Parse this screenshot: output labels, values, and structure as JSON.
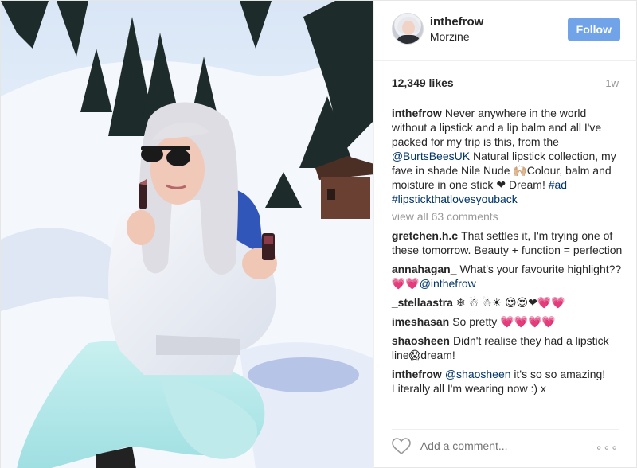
{
  "header": {
    "username": "inthefrow",
    "location": "Morzine",
    "follow_label": "Follow"
  },
  "stats": {
    "likes": "12,349 likes",
    "time_ago": "1w"
  },
  "caption": {
    "user": "inthefrow",
    "text_1": "Never anywhere in the world without a lipstick and a lip balm and all I've packed for my trip is this, from the ",
    "mention": "@BurtsBeesUK",
    "text_2": " Natural lipstick collection, my fave in shade Nile Nude 🙌🏼Colour, balm and moisture in one stick ❤ Dream! ",
    "hashtag_1": "#ad",
    "hashtag_2": "#lipstickthatlovesyouback"
  },
  "view_all": "view all 63 comments",
  "comments": [
    {
      "user": "gretchen.h.c",
      "text": "That settles it, I'm trying one of these tomorrow. Beauty + function = perfection"
    },
    {
      "user": "annahagan_",
      "text": "What's your favourite highlight??💗💗",
      "mention": "@inthefrow"
    },
    {
      "user": "_stellaastra",
      "text": "❄ ☃ ☃☀ 😍😍❤💗💗"
    },
    {
      "user": "imeshasan",
      "text": "So pretty 💗💗💗💗"
    },
    {
      "user": "shaosheen",
      "text": "Didn't realise they had a lipstick line😱dream!"
    },
    {
      "user": "inthefrow",
      "mention": "@shaosheen",
      "text": " it's so so amazing! Literally all I'm wearing now :) x"
    }
  ],
  "footer": {
    "add_comment_placeholder": "Add a comment...",
    "more_label": "∘∘∘"
  },
  "colors": {
    "follow_button": "#70a3e8",
    "link": "#003569"
  }
}
